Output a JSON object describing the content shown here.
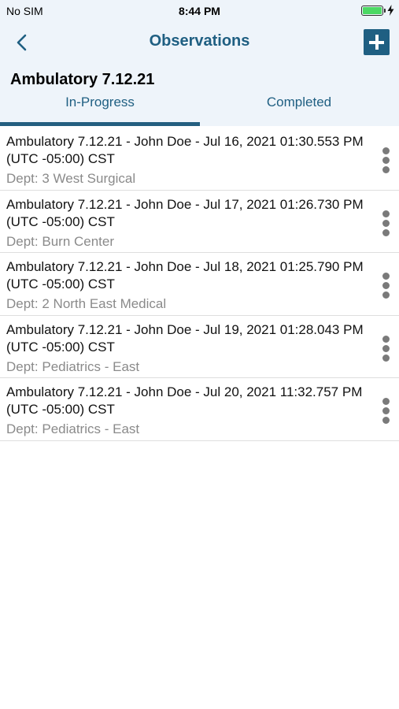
{
  "status_bar": {
    "carrier": "No SIM",
    "time": "8:44 PM",
    "battery_level": 1.0,
    "charging": true
  },
  "nav": {
    "back_icon": "chevron-left-icon",
    "title": "Observations",
    "add_icon": "plus-icon"
  },
  "section": {
    "title": "Ambulatory 7.12.21"
  },
  "tabs": [
    {
      "label": "In-Progress",
      "selected": true
    },
    {
      "label": "Completed",
      "selected": false
    }
  ],
  "dept_prefix": "Dept: ",
  "observations": [
    {
      "title": "Ambulatory 7.12.21 - John Doe - Jul 16, 2021 01:30.553 PM (UTC -05:00) CST",
      "dept": "3 West Surgical"
    },
    {
      "title": "Ambulatory 7.12.21 - John Doe - Jul 17, 2021 01:26.730 PM (UTC -05:00) CST",
      "dept": "Burn Center"
    },
    {
      "title": "Ambulatory 7.12.21 - John Doe - Jul 18, 2021 01:25.790 PM (UTC -05:00) CST",
      "dept": "2 North East Medical"
    },
    {
      "title": "Ambulatory 7.12.21 - John Doe - Jul 19, 2021 01:28.043 PM (UTC -05:00) CST",
      "dept": "Pediatrics - East"
    },
    {
      "title": "Ambulatory 7.12.21 - John Doe - Jul 20, 2021 11:32.757 PM (UTC -05:00) CST",
      "dept": "Pediatrics - East"
    }
  ],
  "colors": {
    "accent": "#1f5f82",
    "header_bg": "#eef4fa",
    "dept_text": "#8a8a8a",
    "battery": "#4cd964"
  }
}
